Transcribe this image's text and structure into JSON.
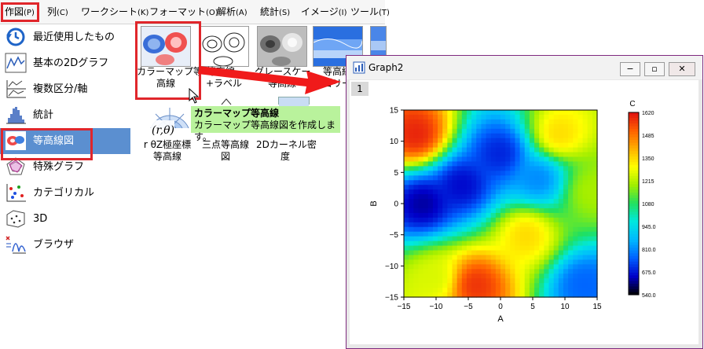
{
  "menu": {
    "items": [
      {
        "label": "作図",
        "accel": "(P)"
      },
      {
        "label": "列",
        "accel": "(C)"
      },
      {
        "label": "ワークシート",
        "accel": "(K)"
      },
      {
        "label": "フォーマット",
        "accel": "(O)"
      },
      {
        "label": "解析",
        "accel": "(A)"
      },
      {
        "label": "統計",
        "accel": "(S)"
      },
      {
        "label": "イメージ",
        "accel": "(I)"
      },
      {
        "label": "ツール",
        "accel": "(T)"
      }
    ]
  },
  "categories": [
    {
      "label": "最近使用したもの",
      "icon": "recent-icon"
    },
    {
      "label": "基本の2Dグラフ",
      "icon": "line-graph-icon"
    },
    {
      "label": "複数区分/軸",
      "icon": "multi-axis-icon"
    },
    {
      "label": "統計",
      "icon": "histogram-icon"
    },
    {
      "label": "等高線図",
      "icon": "contour-icon",
      "selected": true
    },
    {
      "label": "特殊グラフ",
      "icon": "radar-icon"
    },
    {
      "label": "カテゴリカル",
      "icon": "categorical-icon"
    },
    {
      "label": "3D",
      "icon": "3d-scatter-icon"
    },
    {
      "label": "ブラウザ",
      "icon": "browser-icon"
    }
  ],
  "gallery": {
    "row1": [
      {
        "line1": "カラーマップ等",
        "line2": "高線",
        "icon": "colormap-contour-icon"
      },
      {
        "line1": "等高線 -",
        "line2": "+ラベル",
        "icon": "contour-lines-icon"
      },
      {
        "line1": "グレースケー",
        "line2": "等高線",
        "icon": "grayscale-contour-icon"
      },
      {
        "line1": "等高線",
        "line2": "ゴリー",
        "icon": "contour-category-icon"
      }
    ],
    "row2": [
      {
        "line1": "r θZ極座標",
        "line2": "等高線",
        "icon": "polar-contour-icon"
      },
      {
        "line1": "三点等高線",
        "line2": "図",
        "icon": "ternary-contour-icon"
      },
      {
        "line1": "2Dカーネル密",
        "line2": "度",
        "icon": "kernel-density-icon"
      }
    ],
    "polar_glyph": "(r,θ)"
  },
  "tooltip": {
    "title": "カラーマップ等高線",
    "description": "カラーマップ等高線図を作成します。"
  },
  "graph_window": {
    "title": "Graph2",
    "page_number": "1",
    "buttons": {
      "minimize": "−",
      "maximize": "▫",
      "close": "✕"
    }
  },
  "chart_data": {
    "type": "heatmap",
    "xlabel": "A",
    "ylabel": "B",
    "xlim": [
      -15,
      15
    ],
    "ylim": [
      -15,
      15
    ],
    "xticks": [
      -15,
      -10,
      -5,
      0,
      5,
      10,
      15
    ],
    "yticks": [
      -15,
      -10,
      -5,
      0,
      5,
      10,
      15
    ],
    "colorbar": {
      "title": "C",
      "ticks": [
        "1620",
        "1485",
        "1350",
        "1215",
        "1080",
        "945.0",
        "810.0",
        "675.0",
        "540.0"
      ],
      "min": 540,
      "max": 1620,
      "colors": [
        "#000000",
        "#0000c8",
        "#0060ff",
        "#00b8ff",
        "#00e8e0",
        "#20e060",
        "#a0ee00",
        "#ffff00",
        "#ffb000",
        "#ff6000",
        "#e01010"
      ]
    },
    "hotspots": [
      {
        "x": -13,
        "y": 11,
        "value": 1600
      },
      {
        "x": 9,
        "y": 11,
        "value": 1350
      },
      {
        "x": -4,
        "y": -13,
        "value": 1580
      },
      {
        "x": 4,
        "y": -5,
        "value": 1350
      },
      {
        "x": -10,
        "y": -12,
        "value": 1250
      },
      {
        "x": -12,
        "y": 0,
        "value": 620
      },
      {
        "x": -6,
        "y": 3,
        "value": 650
      },
      {
        "x": 0,
        "y": 8,
        "value": 680
      },
      {
        "x": 6,
        "y": 4,
        "value": 800
      },
      {
        "x": 13,
        "y": -13,
        "value": 760
      },
      {
        "x": 14,
        "y": 2,
        "value": 1200
      }
    ]
  }
}
